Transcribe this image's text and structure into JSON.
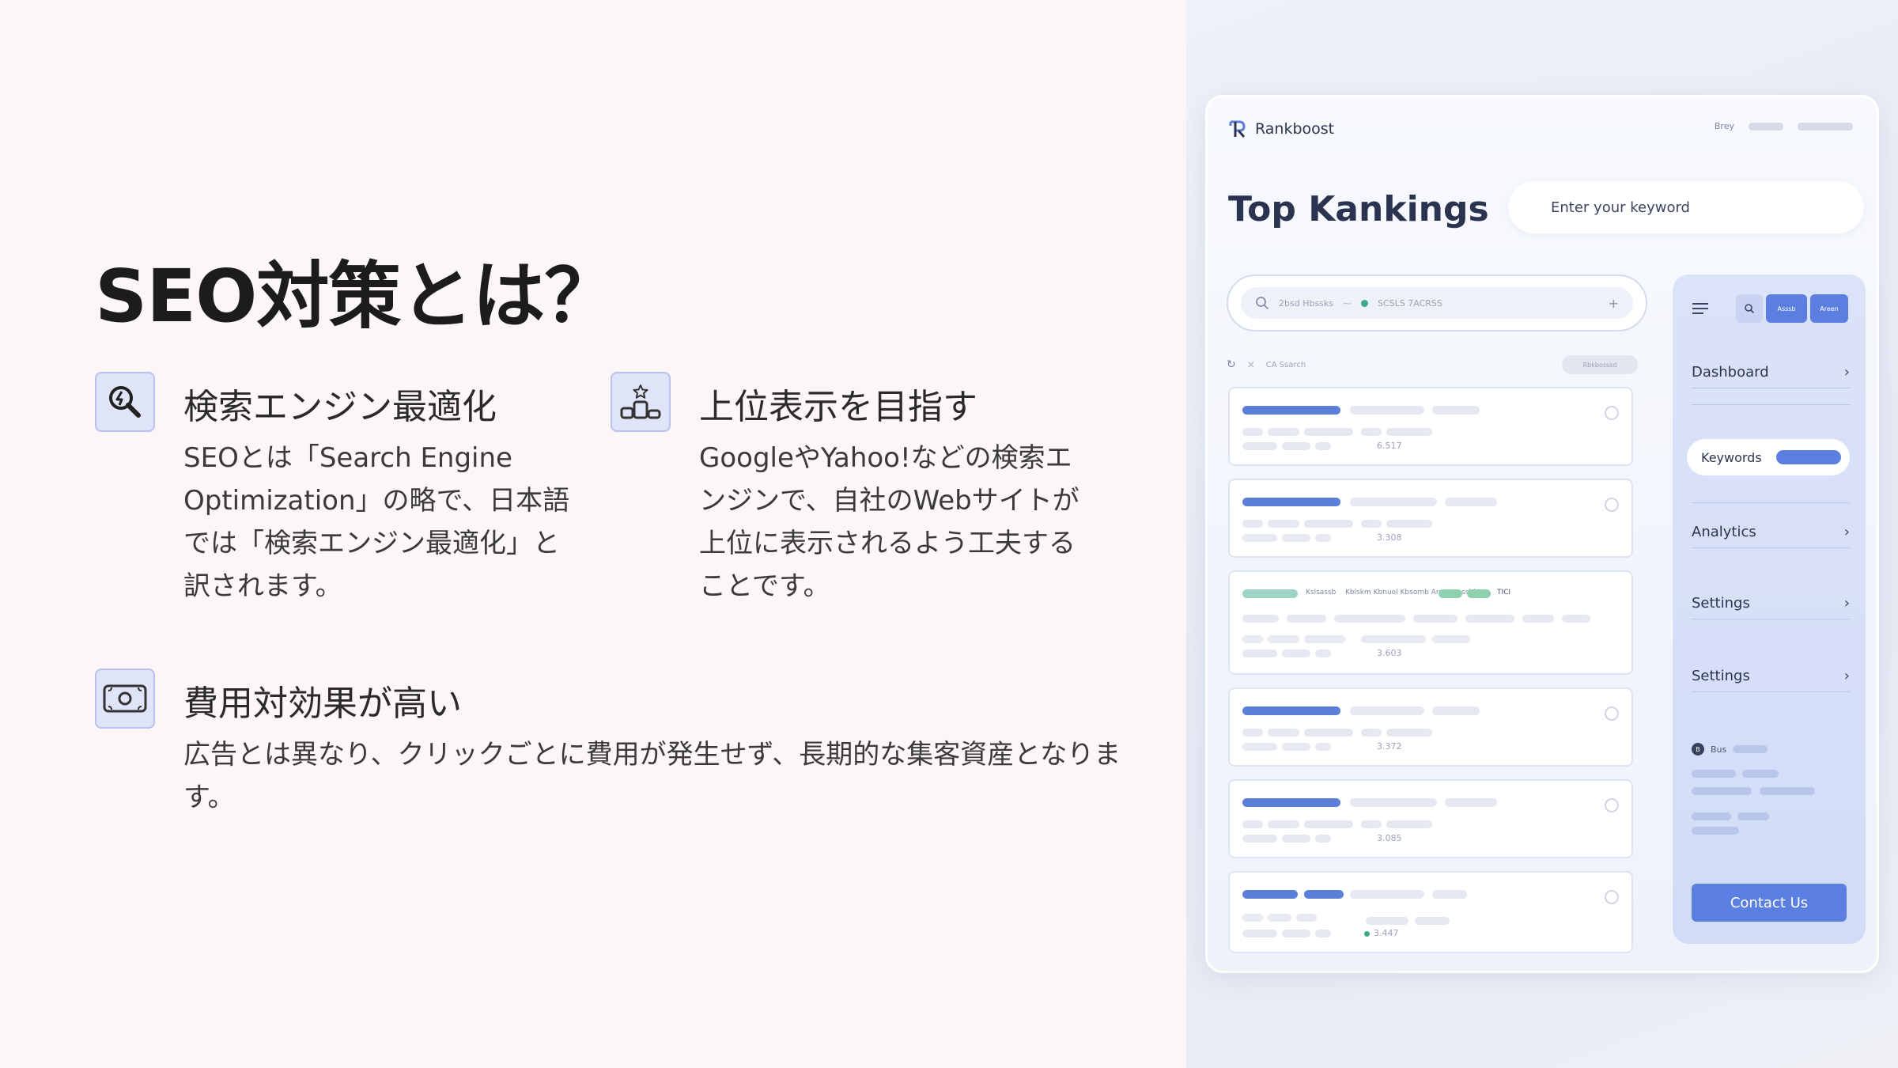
{
  "slide": {
    "title": "SEO対策とは？",
    "features": [
      {
        "title": "検索エンジン最適化",
        "body": "SEOとは「Search Engine Optimization」の略で、日本語では「検索エンジン最適化」と訳されます。",
        "icon": "magnifier-icon"
      },
      {
        "title": "上位表示を目指す",
        "body": "GoogleやYahoo!などの検索エンジンで、自社のWebサイトが上位に表示されるよう工夫することです。",
        "icon": "ranking-podium-icon"
      },
      {
        "title": "費用対効果が高い",
        "body": "広告とは異なり、クリックごとに費用が発生せず、長期的な集客資産となります。",
        "icon": "banknote-icon"
      }
    ]
  },
  "app": {
    "brand": "Rankboost",
    "topright_label": "Brey",
    "heading": "Top Kankings",
    "keyword_placeholder": "Enter your keyword",
    "search_bar": {
      "left_text": "2bsd Hbssks",
      "tag": "SCSLS 7ACRSS"
    },
    "filter_label": "CA Ssarch",
    "filter_pill": "Rbkbosssd",
    "rows": [
      {
        "value": "6.517"
      },
      {
        "value": "3.308"
      },
      {
        "value": "3.603",
        "label_a": "Kslsassb",
        "label_b": "Kblskm Kbnuol Kbsomb Armmoesshb",
        "tag_value": "TICI"
      },
      {
        "value": "3.372"
      },
      {
        "value": "3.085"
      },
      {
        "value": "3.447"
      }
    ],
    "sidebar": {
      "tool_a": "Asssb",
      "tool_b": "Areen",
      "nav": {
        "dashboard": "Dashboard",
        "keywords": "Keywords",
        "analytics": "Analytics",
        "settings_1": "Settings",
        "settings_2": "Settings"
      },
      "user": "Bus",
      "contact": "Contact Us"
    },
    "colors": {
      "accent": "#5b7fe0",
      "sidebar_bg": "#d6dff7"
    }
  }
}
